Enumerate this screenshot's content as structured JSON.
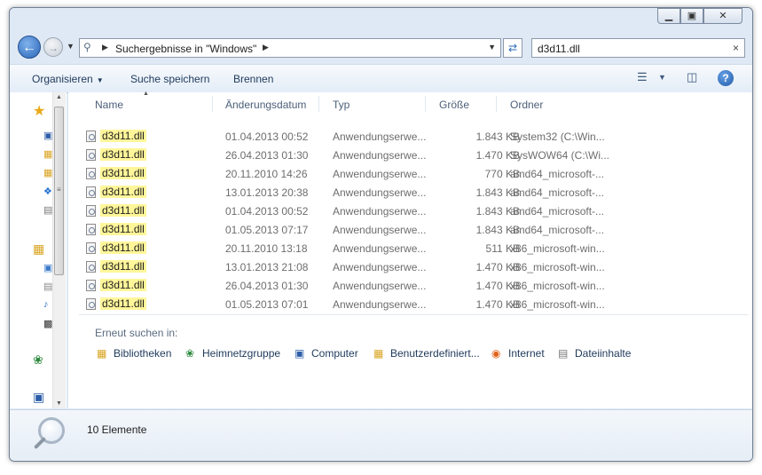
{
  "window": {
    "controls": {
      "minimize": "▁",
      "maximize": "▣",
      "close": "✕"
    }
  },
  "nav": {
    "address_path": "Suchergebnisse in \"Windows\"",
    "search_value": "d3d11.dll"
  },
  "toolbar": {
    "organize_label": "Organisieren",
    "save_search_label": "Suche speichern",
    "burn_label": "Brennen"
  },
  "columns": {
    "name": "Name",
    "date": "Änderungsdatum",
    "type": "Typ",
    "size": "Größe",
    "folder": "Ordner"
  },
  "files": [
    {
      "name": "d3d11.dll",
      "date": "01.04.2013 00:52",
      "type": "Anwendungserwe...",
      "size": "1.843 KB",
      "folder": "System32 (C:\\Win..."
    },
    {
      "name": "d3d11.dll",
      "date": "26.04.2013 01:30",
      "type": "Anwendungserwe...",
      "size": "1.470 KB",
      "folder": "SysWOW64 (C:\\Wi..."
    },
    {
      "name": "d3d11.dll",
      "date": "20.11.2010 14:26",
      "type": "Anwendungserwe...",
      "size": "770 KB",
      "folder": "amd64_microsoft-..."
    },
    {
      "name": "d3d11.dll",
      "date": "13.01.2013 20:38",
      "type": "Anwendungserwe...",
      "size": "1.843 KB",
      "folder": "amd64_microsoft-..."
    },
    {
      "name": "d3d11.dll",
      "date": "01.04.2013 00:52",
      "type": "Anwendungserwe...",
      "size": "1.843 KB",
      "folder": "amd64_microsoft-..."
    },
    {
      "name": "d3d11.dll",
      "date": "01.05.2013 07:17",
      "type": "Anwendungserwe...",
      "size": "1.843 KB",
      "folder": "amd64_microsoft-..."
    },
    {
      "name": "d3d11.dll",
      "date": "20.11.2010 13:18",
      "type": "Anwendungserwe...",
      "size": "511 KB",
      "folder": "x86_microsoft-win..."
    },
    {
      "name": "d3d11.dll",
      "date": "13.01.2013 21:08",
      "type": "Anwendungserwe...",
      "size": "1.470 KB",
      "folder": "x86_microsoft-win..."
    },
    {
      "name": "d3d11.dll",
      "date": "26.04.2013 01:30",
      "type": "Anwendungserwe...",
      "size": "1.470 KB",
      "folder": "x86_microsoft-win..."
    },
    {
      "name": "d3d11.dll",
      "date": "01.05.2013 07:01",
      "type": "Anwendungserwe...",
      "size": "1.470 KB",
      "folder": "x86_microsoft-win..."
    }
  ],
  "search_again": {
    "label": "Erneut suchen in:",
    "locations": [
      {
        "label": "Bibliotheken",
        "icon": "libraries-icon"
      },
      {
        "label": "Heimnetzgruppe",
        "icon": "homegroup-icon"
      },
      {
        "label": "Computer",
        "icon": "computer-icon"
      },
      {
        "label": "Benutzerdefiniert...",
        "icon": "custom-folder-icon"
      },
      {
        "label": "Internet",
        "icon": "firefox-icon"
      },
      {
        "label": "Dateiinhalte",
        "icon": "file-contents-icon"
      }
    ]
  },
  "status": {
    "count": "10 Elemente"
  }
}
